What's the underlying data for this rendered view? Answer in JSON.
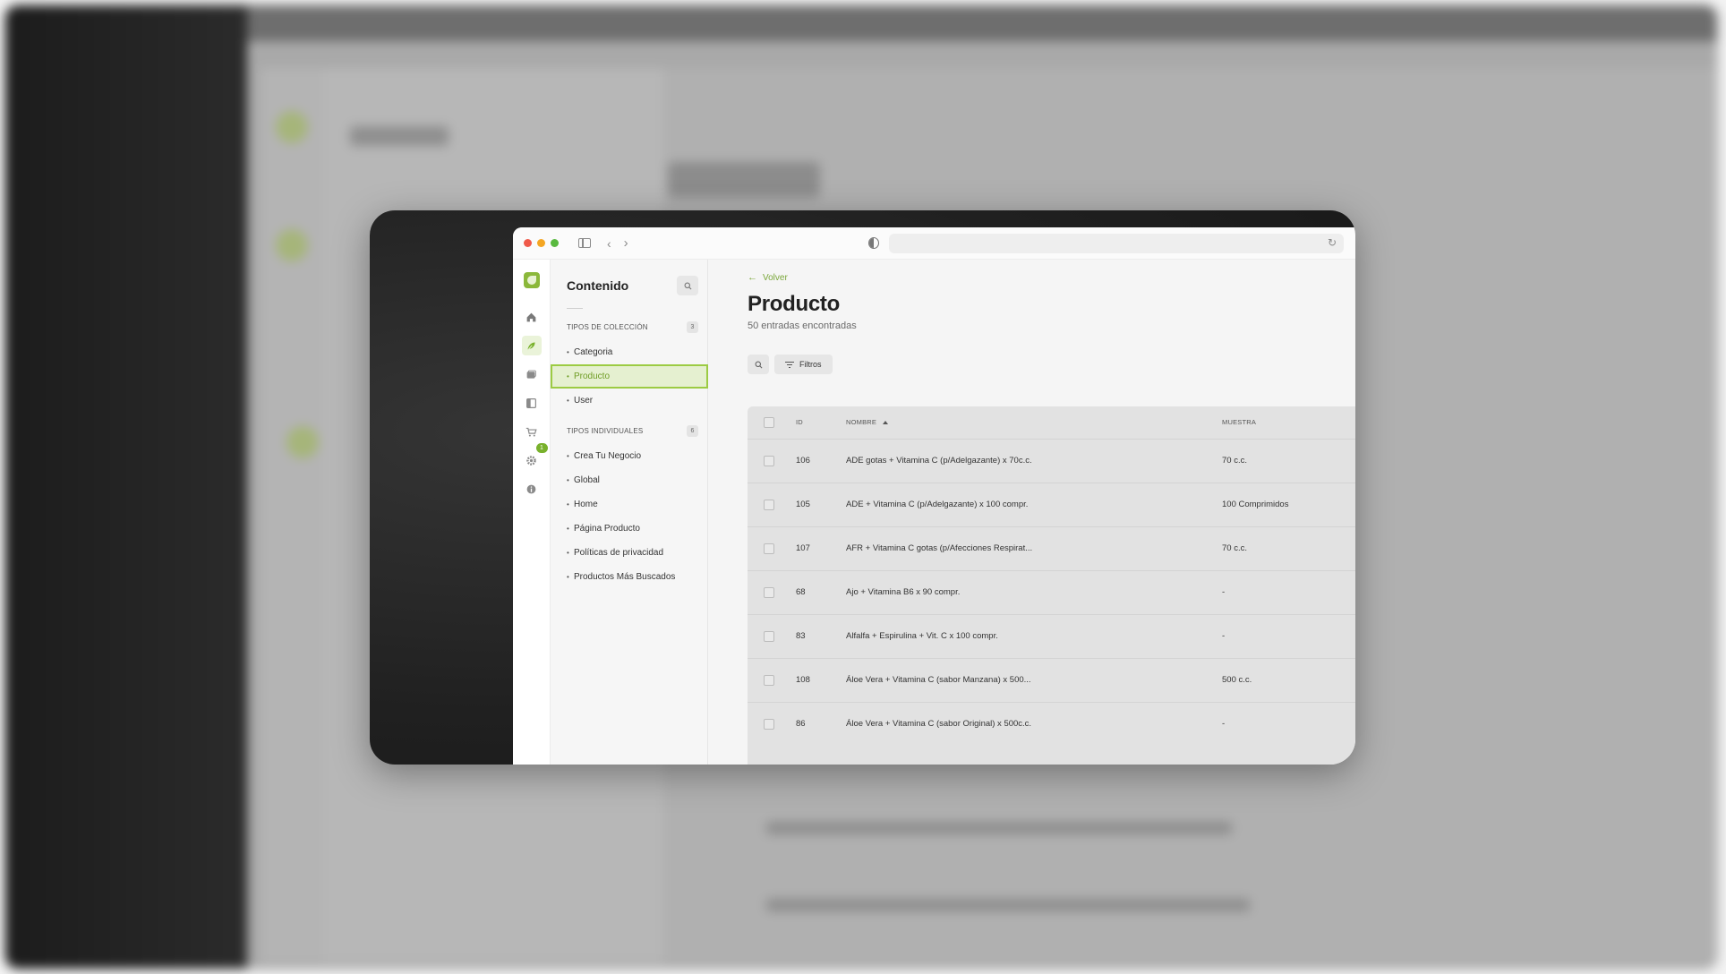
{
  "sidebar": {
    "title": "Contenido",
    "collection_section": {
      "label": "TIPOS DE COLECCIÓN",
      "count": "3"
    },
    "collection_items": [
      {
        "label": "Categoria"
      },
      {
        "label": "Producto"
      },
      {
        "label": "User"
      }
    ],
    "single_section": {
      "label": "TIPOS INDIVIDUALES",
      "count": "6"
    },
    "single_items": [
      {
        "label": "Crea Tu Negocio"
      },
      {
        "label": "Global"
      },
      {
        "label": "Home"
      },
      {
        "label": "Página Producto"
      },
      {
        "label": "Políticas de privacidad"
      },
      {
        "label": "Productos Más Buscados"
      }
    ]
  },
  "nav": {
    "settings_badge": "1"
  },
  "main": {
    "back_label": "Volver",
    "title": "Producto",
    "subtitle": "50 entradas encontradas",
    "filter_label": "Filtros"
  },
  "table": {
    "headers": {
      "id": "ID",
      "name": "NOMBRE",
      "sample": "MUESTRA"
    },
    "rows": [
      {
        "id": "106",
        "name": "ADE gotas + Vitamina C (p/Adelgazante) x 70c.c.",
        "sample": "70 c.c."
      },
      {
        "id": "105",
        "name": "ADE + Vitamina C (p/Adelgazante) x 100 compr.",
        "sample": "100 Comprimidos"
      },
      {
        "id": "107",
        "name": "AFR + Vitamina C gotas (p/Afecciones Respirat...",
        "sample": "70 c.c."
      },
      {
        "id": "68",
        "name": "Ajo + Vitamina B6 x 90 compr.",
        "sample": "-"
      },
      {
        "id": "83",
        "name": "Alfalfa + Espirulina + Vit. C x 100 compr.",
        "sample": "-"
      },
      {
        "id": "108",
        "name": "Áloe Vera + Vitamina C (sabor Manzana) x 500...",
        "sample": "500 c.c."
      },
      {
        "id": "86",
        "name": "Áloe Vera + Vitamina C (sabor Original) x 500c.c.",
        "sample": "-"
      }
    ]
  },
  "colors": {
    "accent": "#8bb83a",
    "accent_text": "#6f9d24",
    "accent_bg": "#e5f0d0"
  }
}
